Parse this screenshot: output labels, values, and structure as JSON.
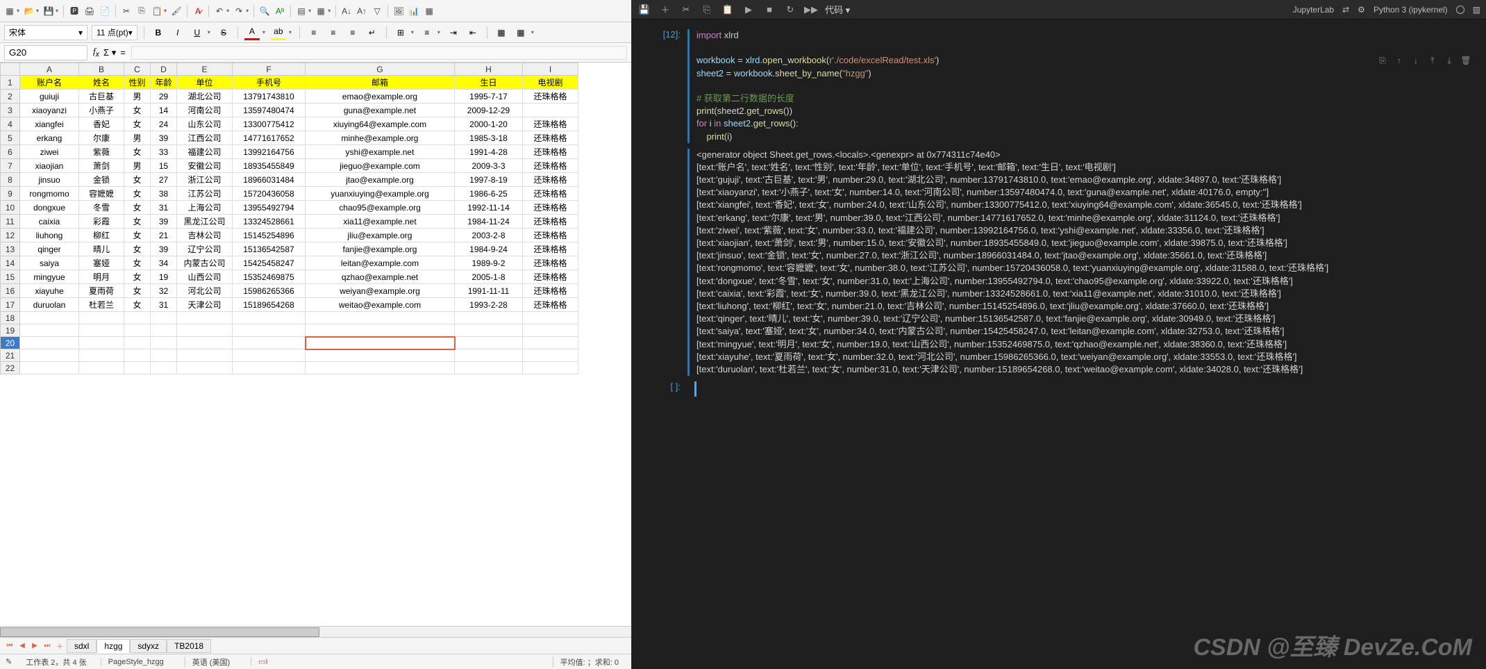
{
  "left": {
    "font_name": "宋体",
    "font_size": "11 点(pt)",
    "cell_ref": "G20",
    "cols": [
      "A",
      "B",
      "C",
      "D",
      "E",
      "F",
      "G",
      "H",
      "I"
    ],
    "header_row": [
      "账户名",
      "姓名",
      "性别",
      "年龄",
      "单位",
      "手机号",
      "邮箱",
      "生日",
      "电视剧"
    ],
    "rows": [
      [
        "guiuji",
        "古巨基",
        "男",
        "29",
        "湖北公司",
        "13791743810",
        "emao@example.org",
        "1995-7-17",
        "还珠格格"
      ],
      [
        "xiaoyanzi",
        "小燕子",
        "女",
        "14",
        "河南公司",
        "13597480474",
        "guna@example.net",
        "2009-12-29",
        ""
      ],
      [
        "xiangfei",
        "香妃",
        "女",
        "24",
        "山东公司",
        "13300775412",
        "xiuying64@example.com",
        "2000-1-20",
        "还珠格格"
      ],
      [
        "erkang",
        "尔康",
        "男",
        "39",
        "江西公司",
        "14771617652",
        "minhe@example.org",
        "1985-3-18",
        "还珠格格"
      ],
      [
        "ziwei",
        "紫薇",
        "女",
        "33",
        "福建公司",
        "13992164756",
        "yshi@example.net",
        "1991-4-28",
        "还珠格格"
      ],
      [
        "xiaojian",
        "萧剑",
        "男",
        "15",
        "安徽公司",
        "18935455849",
        "jieguo@example.com",
        "2009-3-3",
        "还珠格格"
      ],
      [
        "jinsuo",
        "金锁",
        "女",
        "27",
        "浙江公司",
        "18966031484",
        "jtao@example.org",
        "1997-8-19",
        "还珠格格"
      ],
      [
        "rongmomo",
        "容嬷嬷",
        "女",
        "38",
        "江苏公司",
        "15720436058",
        "yuanxiuying@example.org",
        "1986-6-25",
        "还珠格格"
      ],
      [
        "dongxue",
        "冬雪",
        "女",
        "31",
        "上海公司",
        "13955492794",
        "chao95@example.org",
        "1992-11-14",
        "还珠格格"
      ],
      [
        "caixia",
        "彩霞",
        "女",
        "39",
        "黑龙江公司",
        "13324528661",
        "xia11@example.net",
        "1984-11-24",
        "还珠格格"
      ],
      [
        "liuhong",
        "柳红",
        "女",
        "21",
        "吉林公司",
        "15145254896",
        "jliu@example.org",
        "2003-2-8",
        "还珠格格"
      ],
      [
        "qinger",
        "晴儿",
        "女",
        "39",
        "辽宁公司",
        "15136542587",
        "fanjie@example.org",
        "1984-9-24",
        "还珠格格"
      ],
      [
        "saiya",
        "塞娅",
        "女",
        "34",
        "内蒙古公司",
        "15425458247",
        "leitan@example.com",
        "1989-9-2",
        "还珠格格"
      ],
      [
        "mingyue",
        "明月",
        "女",
        "19",
        "山西公司",
        "15352469875",
        "qzhao@example.net",
        "2005-1-8",
        "还珠格格"
      ],
      [
        "xiayuhe",
        "夏雨荷",
        "女",
        "32",
        "河北公司",
        "15986265366",
        "weiyan@example.org",
        "1991-11-11",
        "还珠格格"
      ],
      [
        "duruolan",
        "杜若兰",
        "女",
        "31",
        "天津公司",
        "15189654268",
        "weitao@example.com",
        "1993-2-28",
        "还珠格格"
      ]
    ],
    "sheet_tabs": [
      "sdxl",
      "hzgg",
      "sdyxz",
      "TB2018"
    ],
    "active_tab": "hzgg",
    "status": {
      "sheet": "工作表 2，共 4 张",
      "pagestyle": "PageStyle_hzgg",
      "lang": "英语 (美国)",
      "stats": "平均值: ；求和: 0"
    }
  },
  "jl": {
    "dropdown": "代码",
    "lab": "JupyterLab",
    "gear": "⚙",
    "kernel": "Python 3 (ipykernel)",
    "prompt": "[12]:",
    "empty_prompt": "[ ]:",
    "code_lines": [
      {
        "t": "import",
        "c": "kw"
      },
      {
        "t": " xlrd\n\n",
        "c": ""
      },
      {
        "t": "workbook ",
        "c": "var"
      },
      {
        "t": "= ",
        "c": "op"
      },
      {
        "t": "xlrd",
        "c": "var"
      },
      {
        "t": ".",
        "c": "op"
      },
      {
        "t": "open_workbook",
        "c": "fn"
      },
      {
        "t": "(",
        "c": "op"
      },
      {
        "t": "r",
        "c": "str"
      },
      {
        "t": "'./code/excelRead/test.xls'",
        "c": "str"
      },
      {
        "t": ")\n",
        "c": "op"
      },
      {
        "t": "sheet2 ",
        "c": "var"
      },
      {
        "t": "= ",
        "c": "op"
      },
      {
        "t": "workbook",
        "c": "var"
      },
      {
        "t": ".",
        "c": "op"
      },
      {
        "t": "sheet_by_name",
        "c": "fn"
      },
      {
        "t": "(",
        "c": "op"
      },
      {
        "t": "\"hzgg\"",
        "c": "str"
      },
      {
        "t": ")\n\n",
        "c": "op"
      },
      {
        "t": "# 获取第二行数据的长度\n",
        "c": "cm"
      },
      {
        "t": "print",
        "c": "fn"
      },
      {
        "t": "(sheet2.",
        "c": "op"
      },
      {
        "t": "get_rows",
        "c": "fn"
      },
      {
        "t": "())\n",
        "c": "op"
      },
      {
        "t": "for",
        "c": "kw"
      },
      {
        "t": " i ",
        "c": "var"
      },
      {
        "t": "in",
        "c": "kw"
      },
      {
        "t": " sheet2.",
        "c": "var"
      },
      {
        "t": "get_rows",
        "c": "fn"
      },
      {
        "t": "():\n",
        "c": "op"
      },
      {
        "t": "    ",
        "c": ""
      },
      {
        "t": "print",
        "c": "fn"
      },
      {
        "t": "(i)",
        "c": "op"
      }
    ],
    "output": "<generator object Sheet.get_rows.<locals>.<genexpr> at 0x774311c74e40>\n[text:'账户名', text:'姓名', text:'性别', text:'年龄', text:'单位', text:'手机号', text:'邮箱', text:'生日', text:'电视剧']\n[text:'gujuji', text:'古巨基', text:'男', number:29.0, text:'湖北公司', number:13791743810.0, text:'emao@example.org', xldate:34897.0, text:'还珠格格']\n[text:'xiaoyanzi', text:'小燕子', text:'女', number:14.0, text:'河南公司', number:13597480474.0, text:'guna@example.net', xldate:40176.0, empty:'']\n[text:'xiangfei', text:'香妃', text:'女', number:24.0, text:'山东公司', number:13300775412.0, text:'xiuying64@example.com', xldate:36545.0, text:'还珠格格']\n[text:'erkang', text:'尔康', text:'男', number:39.0, text:'江西公司', number:14771617652.0, text:'minhe@example.org', xldate:31124.0, text:'还珠格格']\n[text:'ziwei', text:'紫薇', text:'女', number:33.0, text:'福建公司', number:13992164756.0, text:'yshi@example.net', xldate:33356.0, text:'还珠格格']\n[text:'xiaojian', text:'萧剑', text:'男', number:15.0, text:'安徽公司', number:18935455849.0, text:'jieguo@example.com', xldate:39875.0, text:'还珠格格']\n[text:'jinsuo', text:'金锁', text:'女', number:27.0, text:'浙江公司', number:18966031484.0, text:'jtao@example.org', xldate:35661.0, text:'还珠格格']\n[text:'rongmomo', text:'容嬷嬷', text:'女', number:38.0, text:'江苏公司', number:15720436058.0, text:'yuanxiuying@example.org', xldate:31588.0, text:'还珠格格']\n[text:'dongxue', text:'冬雪', text:'女', number:31.0, text:'上海公司', number:13955492794.0, text:'chao95@example.org', xldate:33922.0, text:'还珠格格']\n[text:'caixia', text:'彩霞', text:'女', number:39.0, text:'黑龙江公司', number:13324528661.0, text:'xia11@example.net', xldate:31010.0, text:'还珠格格']\n[text:'liuhong', text:'柳红', text:'女', number:21.0, text:'吉林公司', number:15145254896.0, text:'jliu@example.org', xldate:37660.0, text:'还珠格格']\n[text:'qinger', text:'晴儿', text:'女', number:39.0, text:'辽宁公司', number:15136542587.0, text:'fanjie@example.org', xldate:30949.0, text:'还珠格格']\n[text:'saiya', text:'塞娅', text:'女', number:34.0, text:'内蒙古公司', number:15425458247.0, text:'leitan@example.com', xldate:32753.0, text:'还珠格格']\n[text:'mingyue', text:'明月', text:'女', number:19.0, text:'山西公司', number:15352469875.0, text:'qzhao@example.net', xldate:38360.0, text:'还珠格格']\n[text:'xiayuhe', text:'夏雨荷', text:'女', number:32.0, text:'河北公司', number:15986265366.0, text:'weiyan@example.org', xldate:33553.0, text:'还珠格格']\n[text:'duruolan', text:'杜若兰', text:'女', number:31.0, text:'天津公司', number:15189654268.0, text:'weitao@example.com', xldate:34028.0, text:'还珠格格']"
  },
  "watermark": "CSDN @至臻 DevZe.CoM"
}
